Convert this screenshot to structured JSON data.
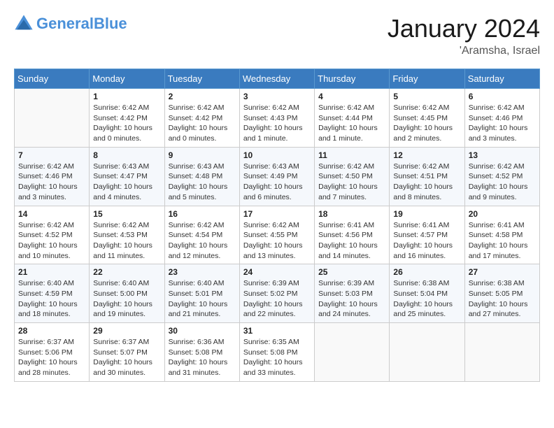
{
  "logo": {
    "general": "General",
    "blue": "Blue"
  },
  "header": {
    "month_year": "January 2024",
    "location": "'Aramsha, Israel"
  },
  "days_of_week": [
    "Sunday",
    "Monday",
    "Tuesday",
    "Wednesday",
    "Thursday",
    "Friday",
    "Saturday"
  ],
  "weeks": [
    [
      {
        "day": "",
        "sunrise": "",
        "sunset": "",
        "daylight": ""
      },
      {
        "day": "1",
        "sunrise": "Sunrise: 6:42 AM",
        "sunset": "Sunset: 4:42 PM",
        "daylight": "Daylight: 10 hours and 0 minutes."
      },
      {
        "day": "2",
        "sunrise": "Sunrise: 6:42 AM",
        "sunset": "Sunset: 4:42 PM",
        "daylight": "Daylight: 10 hours and 0 minutes."
      },
      {
        "day": "3",
        "sunrise": "Sunrise: 6:42 AM",
        "sunset": "Sunset: 4:43 PM",
        "daylight": "Daylight: 10 hours and 1 minute."
      },
      {
        "day": "4",
        "sunrise": "Sunrise: 6:42 AM",
        "sunset": "Sunset: 4:44 PM",
        "daylight": "Daylight: 10 hours and 1 minute."
      },
      {
        "day": "5",
        "sunrise": "Sunrise: 6:42 AM",
        "sunset": "Sunset: 4:45 PM",
        "daylight": "Daylight: 10 hours and 2 minutes."
      },
      {
        "day": "6",
        "sunrise": "Sunrise: 6:42 AM",
        "sunset": "Sunset: 4:46 PM",
        "daylight": "Daylight: 10 hours and 3 minutes."
      }
    ],
    [
      {
        "day": "7",
        "sunrise": "Sunrise: 6:42 AM",
        "sunset": "Sunset: 4:46 PM",
        "daylight": "Daylight: 10 hours and 3 minutes."
      },
      {
        "day": "8",
        "sunrise": "Sunrise: 6:43 AM",
        "sunset": "Sunset: 4:47 PM",
        "daylight": "Daylight: 10 hours and 4 minutes."
      },
      {
        "day": "9",
        "sunrise": "Sunrise: 6:43 AM",
        "sunset": "Sunset: 4:48 PM",
        "daylight": "Daylight: 10 hours and 5 minutes."
      },
      {
        "day": "10",
        "sunrise": "Sunrise: 6:43 AM",
        "sunset": "Sunset: 4:49 PM",
        "daylight": "Daylight: 10 hours and 6 minutes."
      },
      {
        "day": "11",
        "sunrise": "Sunrise: 6:42 AM",
        "sunset": "Sunset: 4:50 PM",
        "daylight": "Daylight: 10 hours and 7 minutes."
      },
      {
        "day": "12",
        "sunrise": "Sunrise: 6:42 AM",
        "sunset": "Sunset: 4:51 PM",
        "daylight": "Daylight: 10 hours and 8 minutes."
      },
      {
        "day": "13",
        "sunrise": "Sunrise: 6:42 AM",
        "sunset": "Sunset: 4:52 PM",
        "daylight": "Daylight: 10 hours and 9 minutes."
      }
    ],
    [
      {
        "day": "14",
        "sunrise": "Sunrise: 6:42 AM",
        "sunset": "Sunset: 4:52 PM",
        "daylight": "Daylight: 10 hours and 10 minutes."
      },
      {
        "day": "15",
        "sunrise": "Sunrise: 6:42 AM",
        "sunset": "Sunset: 4:53 PM",
        "daylight": "Daylight: 10 hours and 11 minutes."
      },
      {
        "day": "16",
        "sunrise": "Sunrise: 6:42 AM",
        "sunset": "Sunset: 4:54 PM",
        "daylight": "Daylight: 10 hours and 12 minutes."
      },
      {
        "day": "17",
        "sunrise": "Sunrise: 6:42 AM",
        "sunset": "Sunset: 4:55 PM",
        "daylight": "Daylight: 10 hours and 13 minutes."
      },
      {
        "day": "18",
        "sunrise": "Sunrise: 6:41 AM",
        "sunset": "Sunset: 4:56 PM",
        "daylight": "Daylight: 10 hours and 14 minutes."
      },
      {
        "day": "19",
        "sunrise": "Sunrise: 6:41 AM",
        "sunset": "Sunset: 4:57 PM",
        "daylight": "Daylight: 10 hours and 16 minutes."
      },
      {
        "day": "20",
        "sunrise": "Sunrise: 6:41 AM",
        "sunset": "Sunset: 4:58 PM",
        "daylight": "Daylight: 10 hours and 17 minutes."
      }
    ],
    [
      {
        "day": "21",
        "sunrise": "Sunrise: 6:40 AM",
        "sunset": "Sunset: 4:59 PM",
        "daylight": "Daylight: 10 hours and 18 minutes."
      },
      {
        "day": "22",
        "sunrise": "Sunrise: 6:40 AM",
        "sunset": "Sunset: 5:00 PM",
        "daylight": "Daylight: 10 hours and 19 minutes."
      },
      {
        "day": "23",
        "sunrise": "Sunrise: 6:40 AM",
        "sunset": "Sunset: 5:01 PM",
        "daylight": "Daylight: 10 hours and 21 minutes."
      },
      {
        "day": "24",
        "sunrise": "Sunrise: 6:39 AM",
        "sunset": "Sunset: 5:02 PM",
        "daylight": "Daylight: 10 hours and 22 minutes."
      },
      {
        "day": "25",
        "sunrise": "Sunrise: 6:39 AM",
        "sunset": "Sunset: 5:03 PM",
        "daylight": "Daylight: 10 hours and 24 minutes."
      },
      {
        "day": "26",
        "sunrise": "Sunrise: 6:38 AM",
        "sunset": "Sunset: 5:04 PM",
        "daylight": "Daylight: 10 hours and 25 minutes."
      },
      {
        "day": "27",
        "sunrise": "Sunrise: 6:38 AM",
        "sunset": "Sunset: 5:05 PM",
        "daylight": "Daylight: 10 hours and 27 minutes."
      }
    ],
    [
      {
        "day": "28",
        "sunrise": "Sunrise: 6:37 AM",
        "sunset": "Sunset: 5:06 PM",
        "daylight": "Daylight: 10 hours and 28 minutes."
      },
      {
        "day": "29",
        "sunrise": "Sunrise: 6:37 AM",
        "sunset": "Sunset: 5:07 PM",
        "daylight": "Daylight: 10 hours and 30 minutes."
      },
      {
        "day": "30",
        "sunrise": "Sunrise: 6:36 AM",
        "sunset": "Sunset: 5:08 PM",
        "daylight": "Daylight: 10 hours and 31 minutes."
      },
      {
        "day": "31",
        "sunrise": "Sunrise: 6:35 AM",
        "sunset": "Sunset: 5:08 PM",
        "daylight": "Daylight: 10 hours and 33 minutes."
      },
      {
        "day": "",
        "sunrise": "",
        "sunset": "",
        "daylight": ""
      },
      {
        "day": "",
        "sunrise": "",
        "sunset": "",
        "daylight": ""
      },
      {
        "day": "",
        "sunrise": "",
        "sunset": "",
        "daylight": ""
      }
    ]
  ]
}
